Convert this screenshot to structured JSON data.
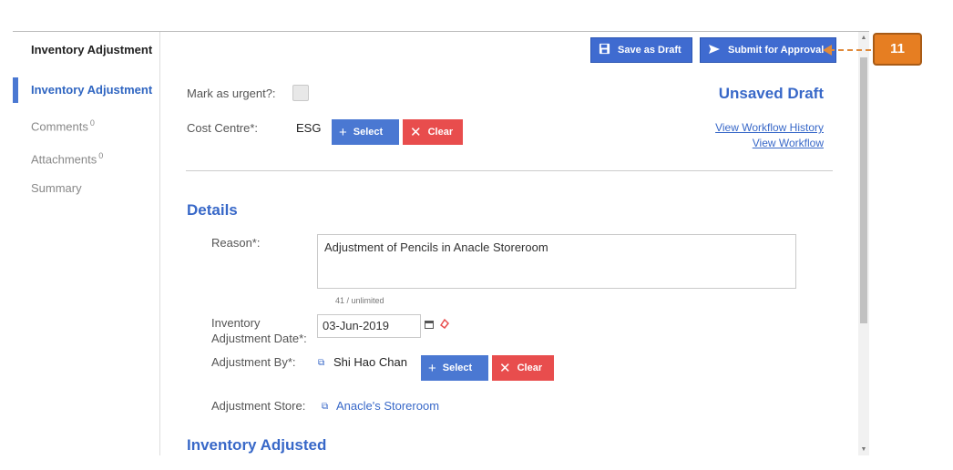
{
  "sidebar": {
    "title": "Inventory Adjustment",
    "items": [
      {
        "label": "Inventory Adjustment",
        "count": ""
      },
      {
        "label": "Comments",
        "count": "0"
      },
      {
        "label": "Attachments",
        "count": "0"
      },
      {
        "label": "Summary",
        "count": ""
      }
    ]
  },
  "toolbar": {
    "save_draft_label": "Save as Draft",
    "save_icon": "floppy-disk-icon",
    "submit_label": "Submit for Approval",
    "submit_icon": "send-arrow-icon"
  },
  "header": {
    "urgent_label": "Mark as urgent?:",
    "urgent_checked": false,
    "cost_centre_label": "Cost Centre*:",
    "cost_centre_value": "ESG",
    "select_label": "Select",
    "clear_label": "Clear",
    "status": "Unsaved Draft",
    "workflow_history_link": "View Workflow History",
    "workflow_link": "View Workflow"
  },
  "details": {
    "section_title": "Details",
    "reason_label": "Reason*:",
    "reason_value": "Adjustment of Pencils in Anacle Storeroom",
    "reason_counter": "41 / unlimited",
    "date_label_line1": "Inventory",
    "date_label_line2": "Adjustment Date*:",
    "date_value": "03-Jun-2019",
    "adjusted_by_label": "Adjustment By*:",
    "adjusted_by_value": "Shi Hao Chan",
    "select_label": "Select",
    "clear_label": "Clear",
    "store_label": "Adjustment Store:",
    "store_value": "Anacle's Storeroom"
  },
  "inventory_adjusted": {
    "section_title": "Inventory Adjusted"
  },
  "annotation": {
    "number": "11"
  },
  "colors": {
    "accent": "#3868c8",
    "button_blue": "#4a78d2",
    "button_red": "#e84d4d",
    "callout_orange": "#e67e22"
  }
}
